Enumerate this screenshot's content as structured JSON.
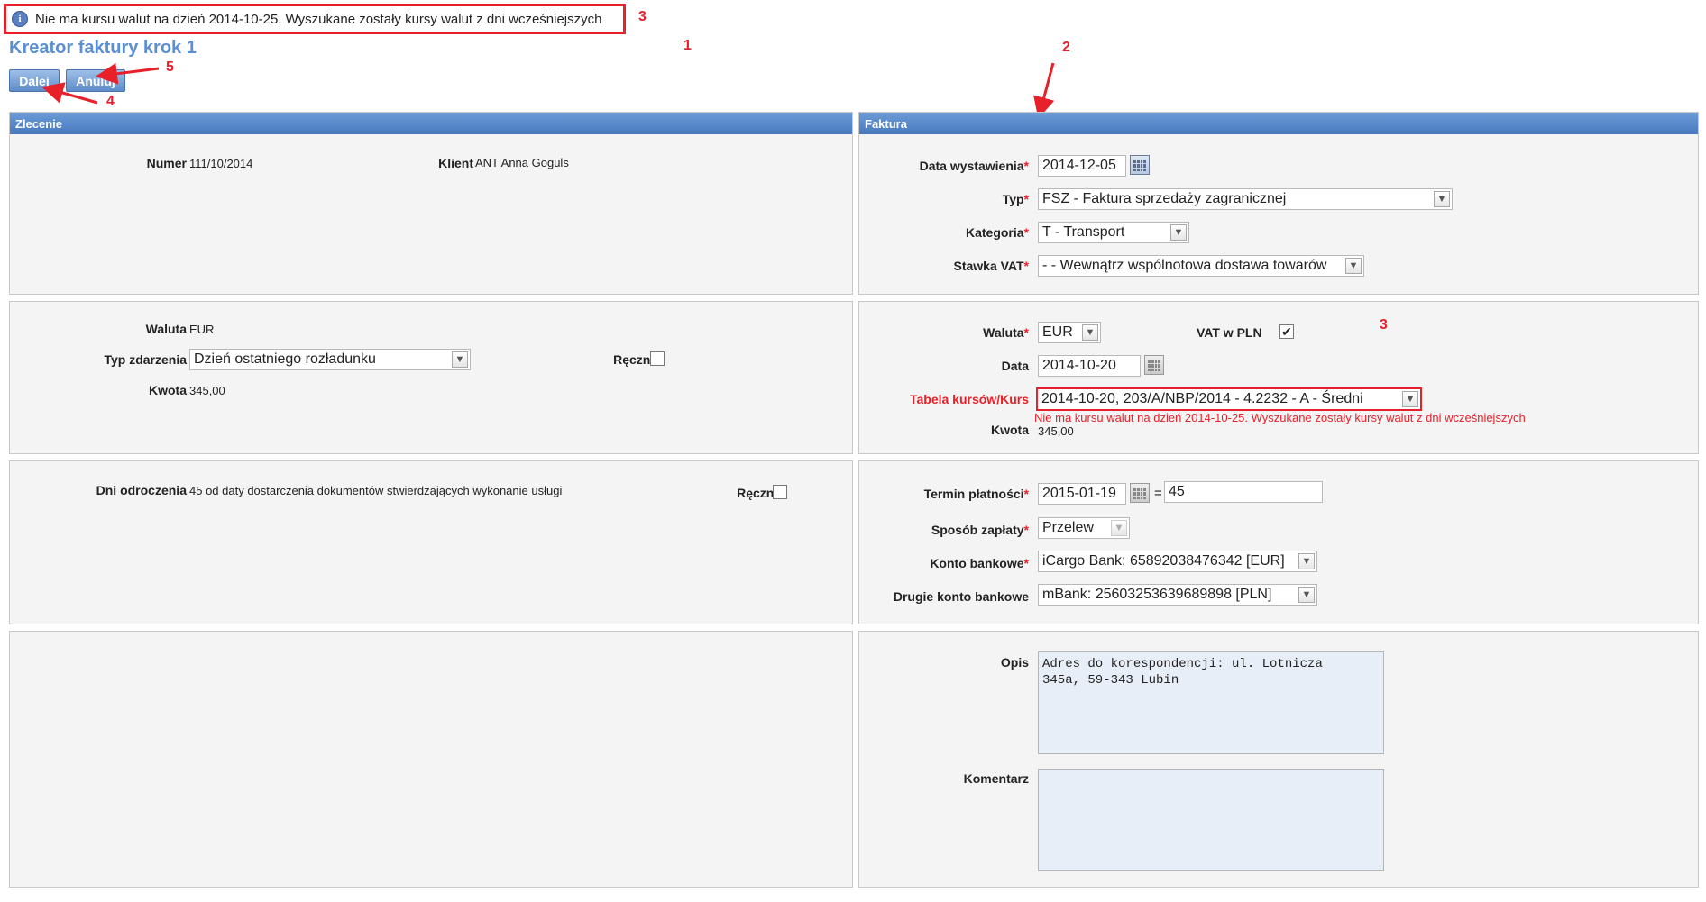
{
  "notice": {
    "text": "Nie ma kursu walut na dzień 2014-10-25. Wyszukane zostały kursy walut z dni wcześniejszych",
    "icon": "info-icon"
  },
  "page": {
    "title": "Kreator faktury krok 1"
  },
  "toolbar": {
    "next_label": "Dalej",
    "cancel_label": "Anuluj"
  },
  "annotations": {
    "a1": "1",
    "a2": "2",
    "a3": "3",
    "a3b": "3",
    "a4": "4",
    "a5": "5"
  },
  "zlecenie": {
    "header": "Zlecenie",
    "numer_label": "Numer",
    "numer": "111/10/2014",
    "klient_label": "Klient",
    "klient": "ANT Anna Goguls",
    "waluta_label": "Waluta",
    "waluta": "EUR",
    "typ_zdarzenia_label": "Typ zdarzenia",
    "typ_zdarzenia": "Dzień ostatniego rozładunku",
    "recznie_label": "Ręcznie",
    "kwota_label": "Kwota",
    "kwota": "345,00",
    "dni_label": "Dni odroczenia",
    "dni": "45 od daty dostarczenia dokumentów stwierdzających wykonanie usługi",
    "recznie2_label": "Ręcznie"
  },
  "faktura": {
    "header": "Faktura",
    "data_wyst_label": "Data wystawienia",
    "data_wyst": "2014-12-05",
    "typ_label": "Typ",
    "typ": "FSZ - Faktura sprzedaży zagranicznej",
    "kategoria_label": "Kategoria",
    "kategoria": "T - Transport",
    "stawka_label": "Stawka VAT",
    "stawka": "- - Wewnątrz wspólnotowa dostawa towarów",
    "waluta_label": "Waluta",
    "waluta": "EUR",
    "vat_pln_label": "VAT w PLN",
    "vat_pln_checked": "✔",
    "data_label": "Data",
    "data": "2014-10-20",
    "tabela_label": "Tabela kursów/Kurs",
    "tabela": "2014-10-20, 203/A/NBP/2014 - 4.2232 - A - Średni",
    "error": "Nie ma kursu walut na dzień 2014-10-25. Wyszukane zostały kursy walut z dni wcześniejszych",
    "kwota_label": "Kwota",
    "kwota": "345,00",
    "termin_label": "Termin płatności",
    "termin": "2015-01-19",
    "eq": "=",
    "termin_days": "45",
    "sposob_label": "Sposób zapłaty",
    "sposob": "Przelew",
    "konto_label": "Konto bankowe",
    "konto": "iCargo Bank: 65892038476342 [EUR]",
    "konto2_label": "Drugie konto bankowe",
    "konto2": "mBank: 25603253639689898 [PLN]",
    "opis_label": "Opis",
    "opis": "Adres do korespondencji: ul. Lotnicza\n345a, 59-343 Lubin",
    "komentarz_label": "Komentarz",
    "komentarz": ""
  },
  "colors": {
    "accent": "#5b8fd4",
    "header": "#4879bf",
    "error": "#e8202a"
  }
}
